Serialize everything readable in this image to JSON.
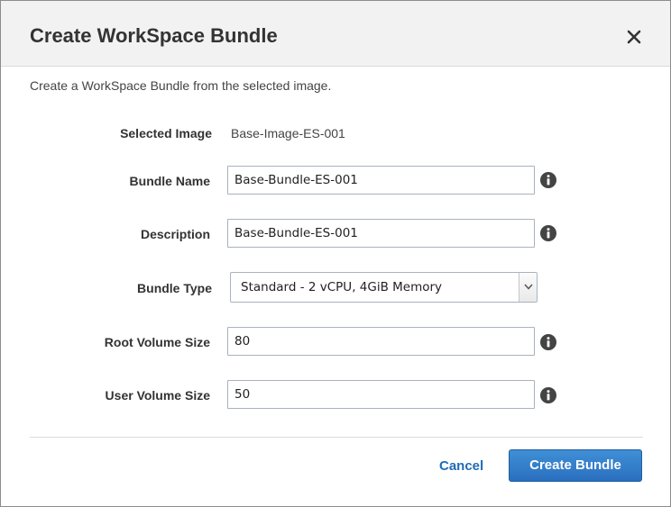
{
  "dialog": {
    "title": "Create WorkSpace Bundle",
    "intro": "Create a WorkSpace Bundle from the selected image."
  },
  "form": {
    "selected_image": {
      "label": "Selected Image",
      "value": "Base-Image-ES-001"
    },
    "bundle_name": {
      "label": "Bundle Name",
      "value": "Base-Bundle-ES-001"
    },
    "description": {
      "label": "Description",
      "value": "Base-Bundle-ES-001"
    },
    "bundle_type": {
      "label": "Bundle Type",
      "value": "Standard - 2 vCPU, 4GiB Memory"
    },
    "root_volume_size": {
      "label": "Root Volume Size",
      "value": "80"
    },
    "user_volume_size": {
      "label": "User Volume Size",
      "value": "50"
    }
  },
  "footer": {
    "cancel_label": "Cancel",
    "create_label": "Create Bundle"
  },
  "icons": {
    "close": "close-icon",
    "info": "info-icon",
    "dropdown": "chevron-down-icon"
  },
  "colors": {
    "primary_button": "#2f7ccb",
    "link": "#1f6bb7",
    "header_bg": "#f2f2f2"
  }
}
